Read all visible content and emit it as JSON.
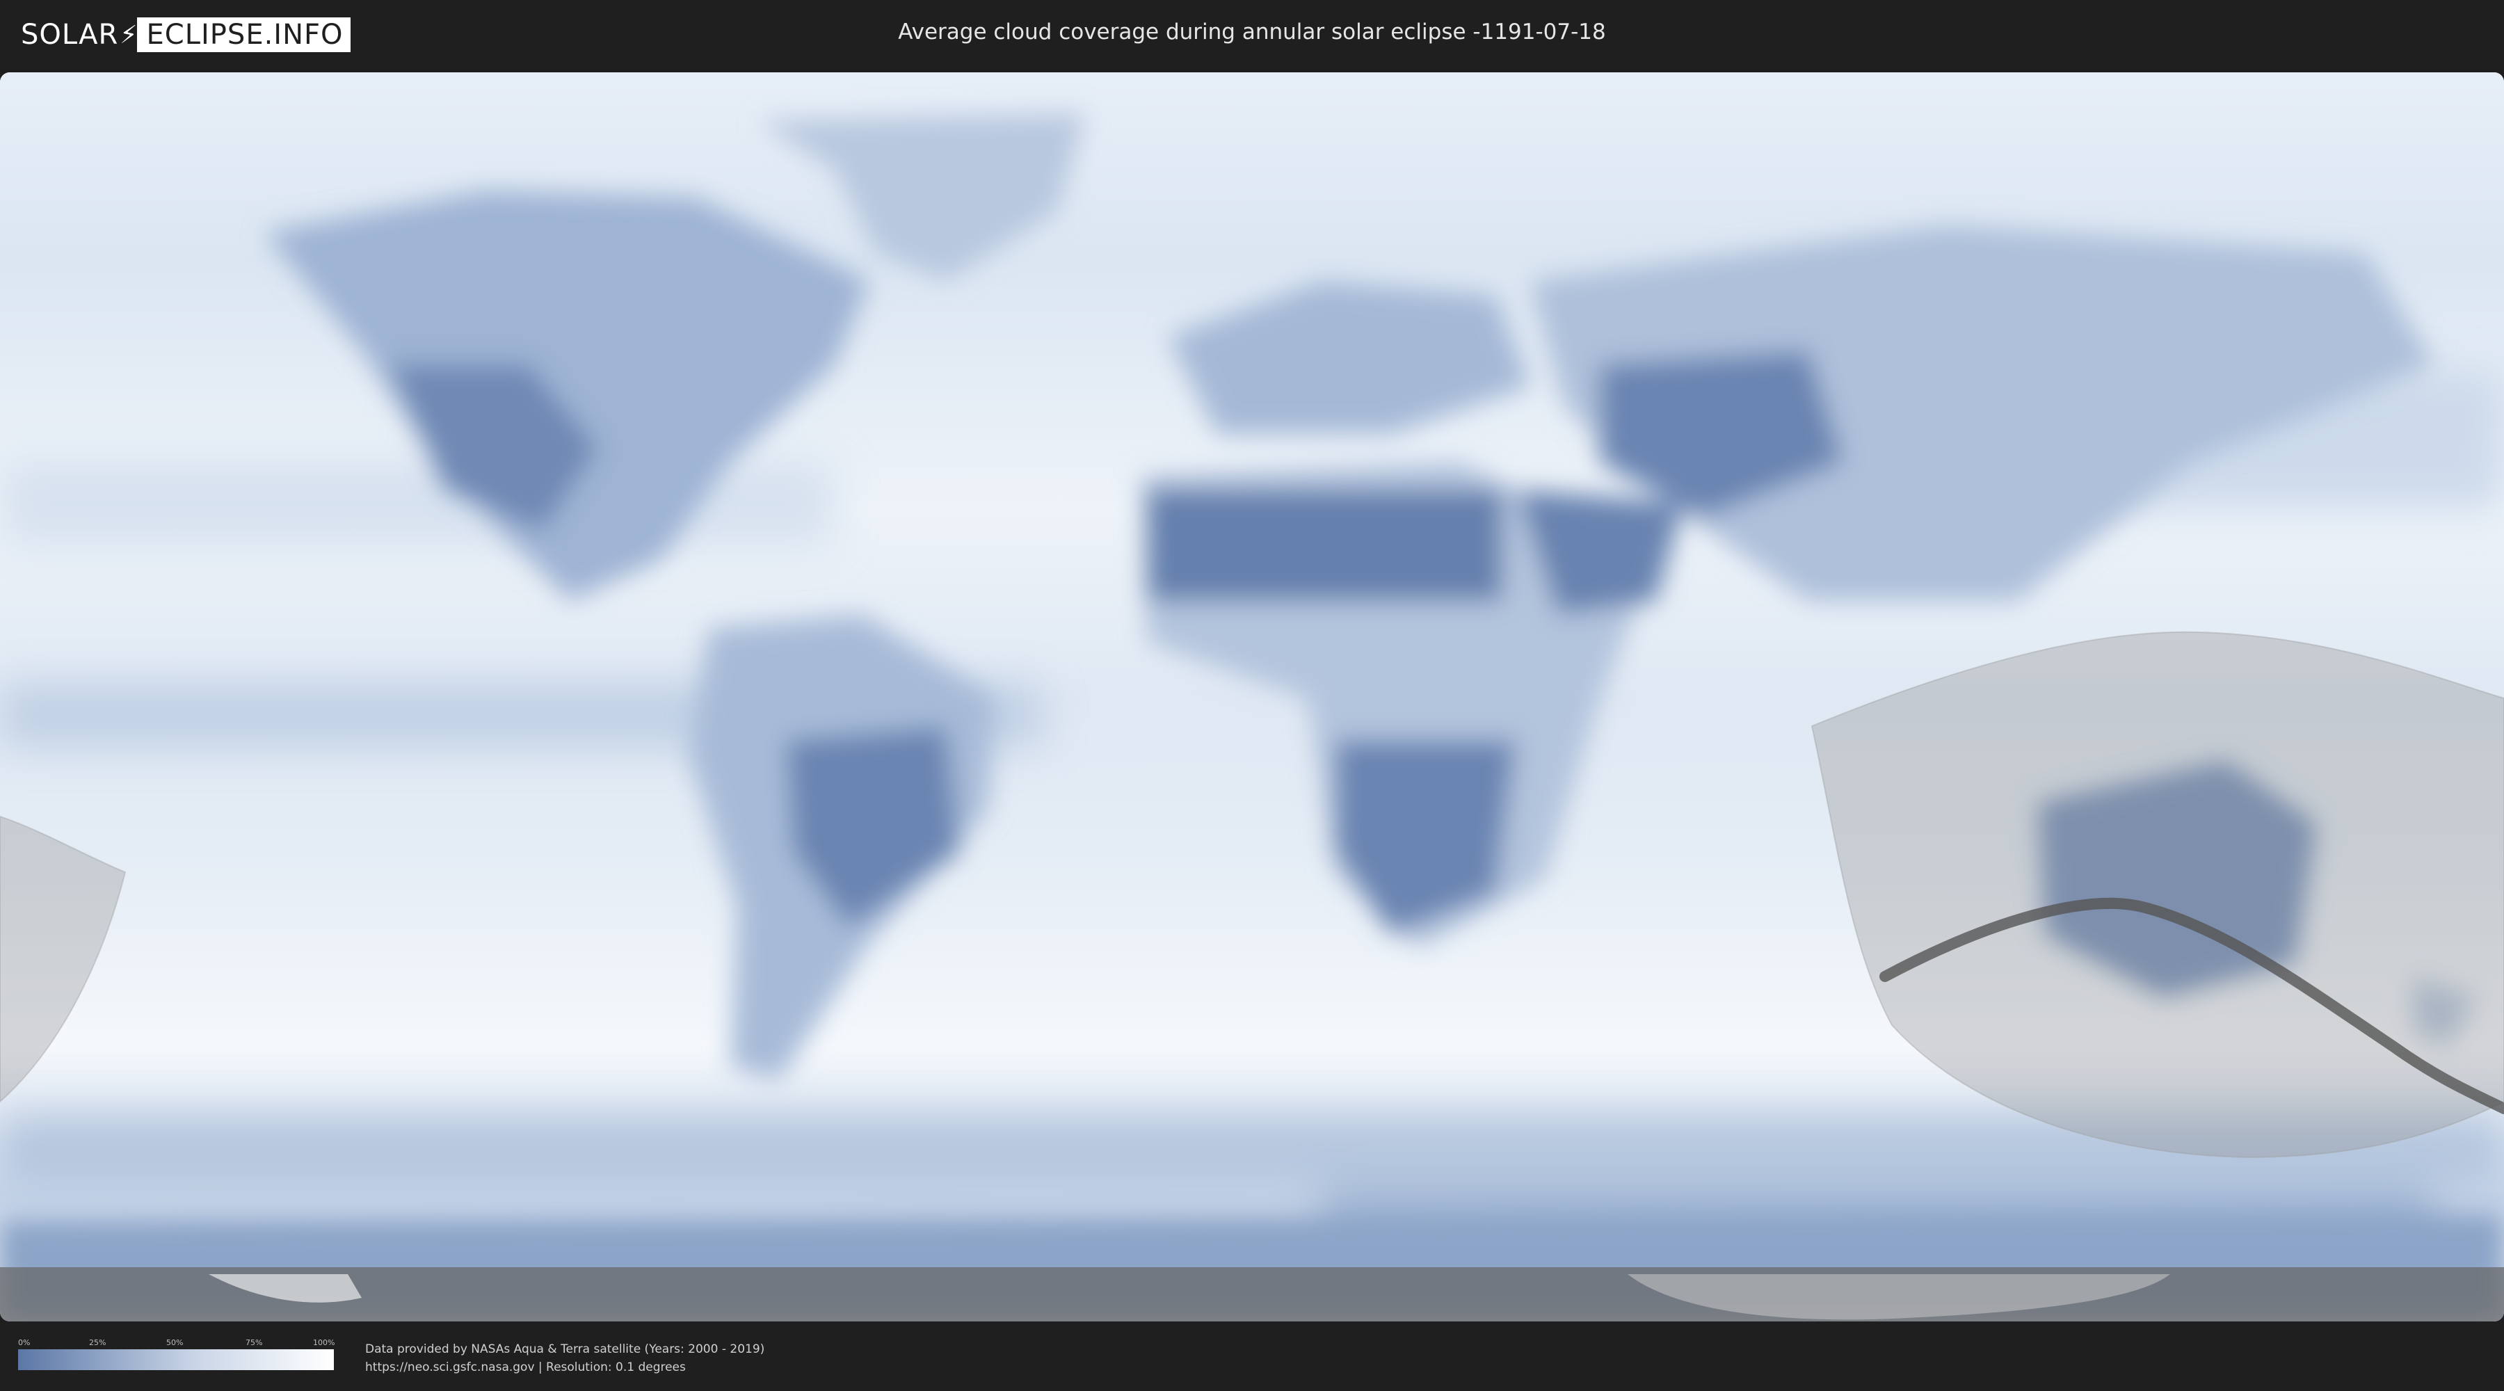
{
  "header": {
    "logo_part1": "SOLAR",
    "logo_part2": "ECLIPSE.INFO",
    "title": "Average cloud coverage during annular solar eclipse -1191-07-18"
  },
  "map": {
    "colors": {
      "ocean_clear": "#f2f6fb",
      "cloud_low": "#5b77a6",
      "land_clear": "#6b86b3",
      "eclipse_shade": "#9a9a9a",
      "central_path": "#555555"
    }
  },
  "legend": {
    "ticks": [
      "0%",
      "25%",
      "50%",
      "75%",
      "100%"
    ]
  },
  "footer": {
    "credit_line1": "Data provided by NASAs Aqua & Terra satellite (Years: 2000 - 2019)",
    "credit_line2": "https://neo.sci.gsfc.nasa.gov | Resolution: 0.1 degrees"
  }
}
